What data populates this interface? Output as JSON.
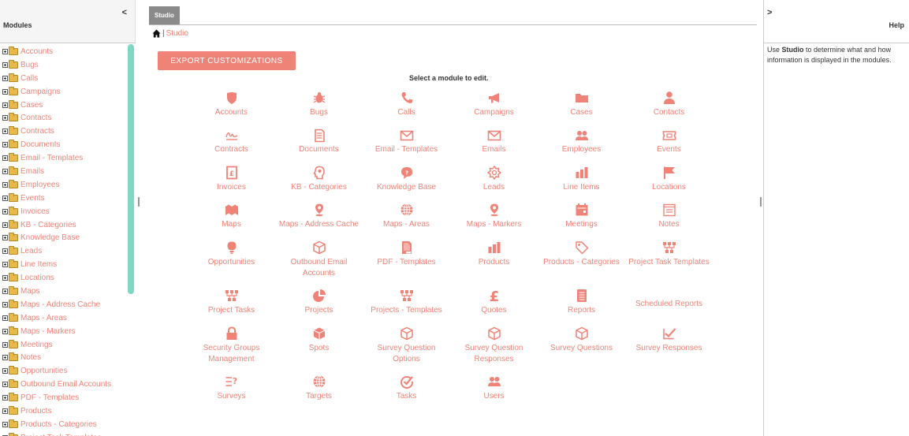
{
  "left_panel": {
    "title": "Modules",
    "collapse": "<",
    "tree": [
      "Accounts",
      "Bugs",
      "Calls",
      "Campaigns",
      "Cases",
      "Contacts",
      "Contracts",
      "Documents",
      "Email - Templates",
      "Emails",
      "Employees",
      "Events",
      "Invoices",
      "KB - Categories",
      "Knowledge Base",
      "Leads",
      "Line Items",
      "Locations",
      "Maps",
      "Maps - Address Cache",
      "Maps - Areas",
      "Maps - Markers",
      "Meetings",
      "Notes",
      "Opportunities",
      "Outbound Email Accounts",
      "PDF - Templates",
      "Products",
      "Products - Categories",
      "Project Task Templates"
    ]
  },
  "center": {
    "tab": "Studio",
    "breadcrumb": {
      "separator": "|",
      "link": "Studio"
    },
    "export_button": "EXPORT CUSTOMIZATIONS",
    "instruction": "Select a module to edit.",
    "modules": [
      {
        "l1": "Accounts",
        "l2": "",
        "icon": "shield-icon"
      },
      {
        "l1": "Bugs",
        "l2": "",
        "icon": "bug-icon"
      },
      {
        "l1": "Calls",
        "l2": "",
        "icon": "phone-icon"
      },
      {
        "l1": "Campaigns",
        "l2": "",
        "icon": "megaphone-icon"
      },
      {
        "l1": "Cases",
        "l2": "",
        "icon": "folder-icon"
      },
      {
        "l1": "Contacts",
        "l2": "",
        "icon": "person-icon"
      },
      {
        "l1": "Contracts",
        "l2": "",
        "icon": "signature-icon"
      },
      {
        "l1": "Documents",
        "l2": "",
        "icon": "document-icon"
      },
      {
        "l1": "Email - Templates",
        "l2": "",
        "icon": "envelope-icon"
      },
      {
        "l1": "Emails",
        "l2": "",
        "icon": "envelope-icon"
      },
      {
        "l1": "Employees",
        "l2": "",
        "icon": "people-icon"
      },
      {
        "l1": "Events",
        "l2": "",
        "icon": "ticket-icon"
      },
      {
        "l1": "Invoices",
        "l2": "",
        "icon": "invoice-icon"
      },
      {
        "l1": "KB - Categories",
        "l2": "",
        "icon": "head-icon"
      },
      {
        "l1": "Knowledge Base",
        "l2": "",
        "icon": "speech-bubble-icon"
      },
      {
        "l1": "Leads",
        "l2": "",
        "icon": "star-badge-icon"
      },
      {
        "l1": "Line Items",
        "l2": "",
        "icon": "bars-icon"
      },
      {
        "l1": "Locations",
        "l2": "",
        "icon": "flag-icon"
      },
      {
        "l1": "Maps",
        "l2": "",
        "icon": "map-icon"
      },
      {
        "l1": "Maps - Address Cache",
        "l2": "",
        "icon": "map-pin-icon"
      },
      {
        "l1": "Maps - Areas",
        "l2": "",
        "icon": "globe-icon"
      },
      {
        "l1": "Maps - Markers",
        "l2": "",
        "icon": "map-pin-icon"
      },
      {
        "l1": "Meetings",
        "l2": "",
        "icon": "calendar-icon"
      },
      {
        "l1": "Notes",
        "l2": "",
        "icon": "notepad-icon"
      },
      {
        "l1": "Opportunities",
        "l2": "",
        "icon": "lightbulb-icon"
      },
      {
        "l1": "Outbound Email",
        "l2": "Accounts",
        "icon": "cube-icon"
      },
      {
        "l1": "PDF - Templates",
        "l2": "",
        "icon": "pdf-icon"
      },
      {
        "l1": "Products",
        "l2": "",
        "icon": "bars-icon"
      },
      {
        "l1": "Products - Categories",
        "l2": "",
        "icon": "tag-icon"
      },
      {
        "l1": "Project Task Templates",
        "l2": "",
        "icon": "hierarchy-icon"
      },
      {
        "l1": "Project Tasks",
        "l2": "",
        "icon": "hierarchy-icon"
      },
      {
        "l1": "Projects",
        "l2": "",
        "icon": "pie-icon"
      },
      {
        "l1": "Projects - Templates",
        "l2": "",
        "icon": "hierarchy-icon"
      },
      {
        "l1": "Quotes",
        "l2": "",
        "icon": "pound-icon"
      },
      {
        "l1": "Reports",
        "l2": "",
        "icon": "report-icon"
      },
      {
        "l1": "Scheduled Reports",
        "l2": "",
        "icon": ""
      },
      {
        "l1": "Security Groups",
        "l2": "Management",
        "icon": "lock-icon"
      },
      {
        "l1": "Spots",
        "l2": "",
        "icon": "box-icon"
      },
      {
        "l1": "Survey Question",
        "l2": "Options",
        "icon": "cube-icon"
      },
      {
        "l1": "Survey Question",
        "l2": "Responses",
        "icon": "cube-icon"
      },
      {
        "l1": "Survey Questions",
        "l2": "",
        "icon": "cube-icon"
      },
      {
        "l1": "Survey Responses",
        "l2": "",
        "icon": "checkmark-icon"
      },
      {
        "l1": "Surveys",
        "l2": "",
        "icon": "question-list-icon"
      },
      {
        "l1": "Targets",
        "l2": "",
        "icon": "globe-icon"
      },
      {
        "l1": "Tasks",
        "l2": "",
        "icon": "check-circle-icon"
      },
      {
        "l1": "Users",
        "l2": "",
        "icon": "people-icon"
      }
    ]
  },
  "right_panel": {
    "collapse": ">",
    "title": "Help",
    "help_prefix": "Use ",
    "help_bold": "Studio",
    "help_suffix": " to determine what and how information is displayed in the modules."
  },
  "colors": {
    "accent": "#f08377",
    "tab": "#8a8a8a",
    "scroll_thumb": "#7fd8c4"
  }
}
